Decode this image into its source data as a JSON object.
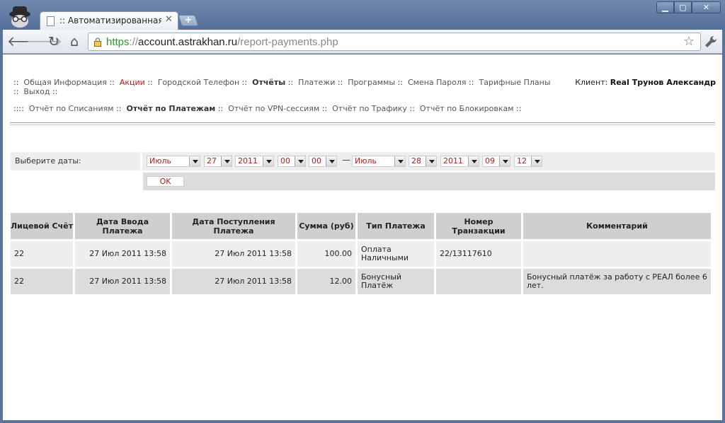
{
  "browser": {
    "tab_title": ":: Автоматизированная Си",
    "url_scheme": "https",
    "url_sep": "://",
    "url_host": "account.astrakhan.ru",
    "url_path": "/report-payments.php",
    "win_min": "▁",
    "win_max": "▢",
    "win_close": "✕"
  },
  "nav": {
    "sep": "::",
    "items": [
      {
        "label": "Общая Информация",
        "style": "normal"
      },
      {
        "label": "Акции",
        "style": "red"
      },
      {
        "label": "Городской Телефон",
        "style": "normal"
      },
      {
        "label": "Отчёты",
        "style": "bold"
      },
      {
        "label": "Платежи",
        "style": "normal"
      },
      {
        "label": "Программы",
        "style": "normal"
      },
      {
        "label": "Смена Пароля",
        "style": "normal"
      },
      {
        "label": "Тарифные Планы",
        "style": "normal"
      },
      {
        "label": "Выход",
        "style": "normal"
      }
    ],
    "client_prefix": "Клиент:",
    "client_name": "Real Трунов Александр"
  },
  "subnav": {
    "lead": "::::",
    "items": [
      {
        "label": "Отчёт по Списаниям",
        "style": "normal"
      },
      {
        "label": "Отчёт по Платежам",
        "style": "bold"
      },
      {
        "label": "Отчёт по VPN-сессиям",
        "style": "normal"
      },
      {
        "label": "Отчёт по Трафику",
        "style": "normal"
      },
      {
        "label": "Отчёт по Блокировкам",
        "style": "normal"
      }
    ]
  },
  "form": {
    "label": "Выберите даты:",
    "from": {
      "month": "Июль",
      "day": "27",
      "year": "2011",
      "hour": "00",
      "minute": "00"
    },
    "dash": "—",
    "to": {
      "month": "Июль",
      "day": "28",
      "year": "2011",
      "hour": "09",
      "minute": "12"
    },
    "ok_label": "OK"
  },
  "table": {
    "headers": [
      "Лицевой Счёт",
      "Дата Ввода Платежа",
      "Дата Поступления Платежа",
      "Сумма (руб)",
      "Тип Платежа",
      "Номер Транзакции",
      "Комментарий"
    ],
    "rows": [
      {
        "account": "22",
        "entered": "27 Июл 2011  13:58",
        "received": "27 Июл 2011  13:58",
        "sum": "100.00",
        "type": "Оплата Наличными",
        "txn": "22/13117610",
        "comment": ""
      },
      {
        "account": "22",
        "entered": "27 Июл 2011  13:58",
        "received": "27 Июл 2011  13:58",
        "sum": "12.00",
        "type": "Бонусный Платёж",
        "txn": "",
        "comment": "Бонусный платёж за работу с РЕАЛ более 6 лет."
      }
    ]
  },
  "colors": {
    "accent_red": "#cc1111",
    "table_header": "#cfcfcf",
    "row_light": "#eeeeee",
    "row_dark": "#dcdcdc"
  }
}
